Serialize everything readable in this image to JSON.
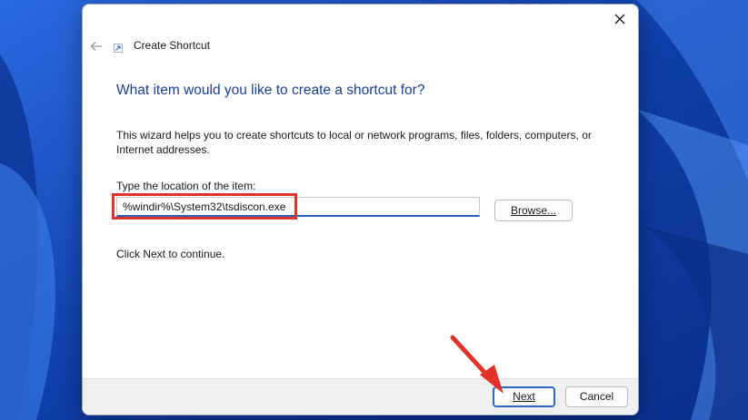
{
  "dialog": {
    "title": "Create Shortcut",
    "heading": "What item would you like to create a shortcut for?",
    "description": "This wizard helps you to create shortcuts to local or network programs, files, folders, computers, or Internet addresses.",
    "location_label": "Type the location of the item:",
    "location_value": "%windir%\\System32\\tsdiscon.exe",
    "browse_label": "Browse...",
    "hint": "Click Next to continue.",
    "next_label": "Next",
    "cancel_label": "Cancel"
  },
  "icons": {
    "close": "close-icon",
    "back": "back-arrow-icon",
    "wizard": "shortcut-wizard-icon"
  },
  "colors": {
    "heading": "#1c3f94",
    "highlight": "#e3322a",
    "accent": "#2e66c8"
  }
}
